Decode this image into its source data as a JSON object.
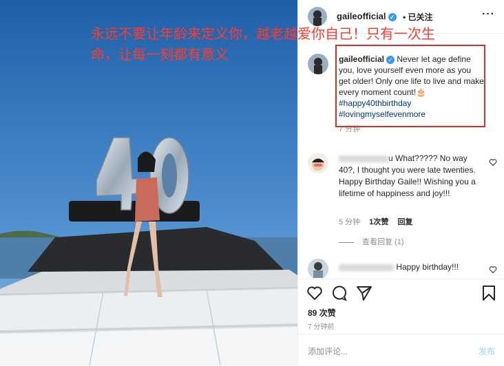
{
  "overlay": {
    "line1": "永远不要让年龄来定义你，越老越爱你自己！只有一次生",
    "line2": "命，让每一刻都有意义"
  },
  "header": {
    "username": "gaileofficial",
    "separator": "•",
    "follow_label": "已关注",
    "more_icon": "ellipsis-icon"
  },
  "caption": {
    "username": "gaileofficial",
    "text": "Never let age define you, love yourself even more as you get older! Only one life to live and make every moment count!",
    "emoji": "🎂",
    "hashtags": [
      "#happy40thbirthday",
      "#lovingmyselfevenmore"
    ],
    "time": "7 分钟"
  },
  "comments": [
    {
      "username_visible": "u",
      "text_line1": "What????? No way 40?,",
      "text_rest": "I thought you were late twenties. Happy Birthday Gaile!! Wishing you a lifetime of happiness and joy!!!",
      "time": "5 分钟",
      "likes": "1次赞",
      "reply": "回复",
      "view_replies": "查看回复 (1)"
    },
    {
      "text": "Happy birthday!!!"
    }
  ],
  "actions": {
    "likes": "89 次赞",
    "ago": "7 分钟前"
  },
  "add_comment": {
    "placeholder": "添加评论...",
    "post": "发布"
  },
  "colors": {
    "overlay_red": "#ff3b30",
    "box_red": "#d0312d",
    "link_blue": "#00376b",
    "verified_blue": "#3897f0"
  }
}
